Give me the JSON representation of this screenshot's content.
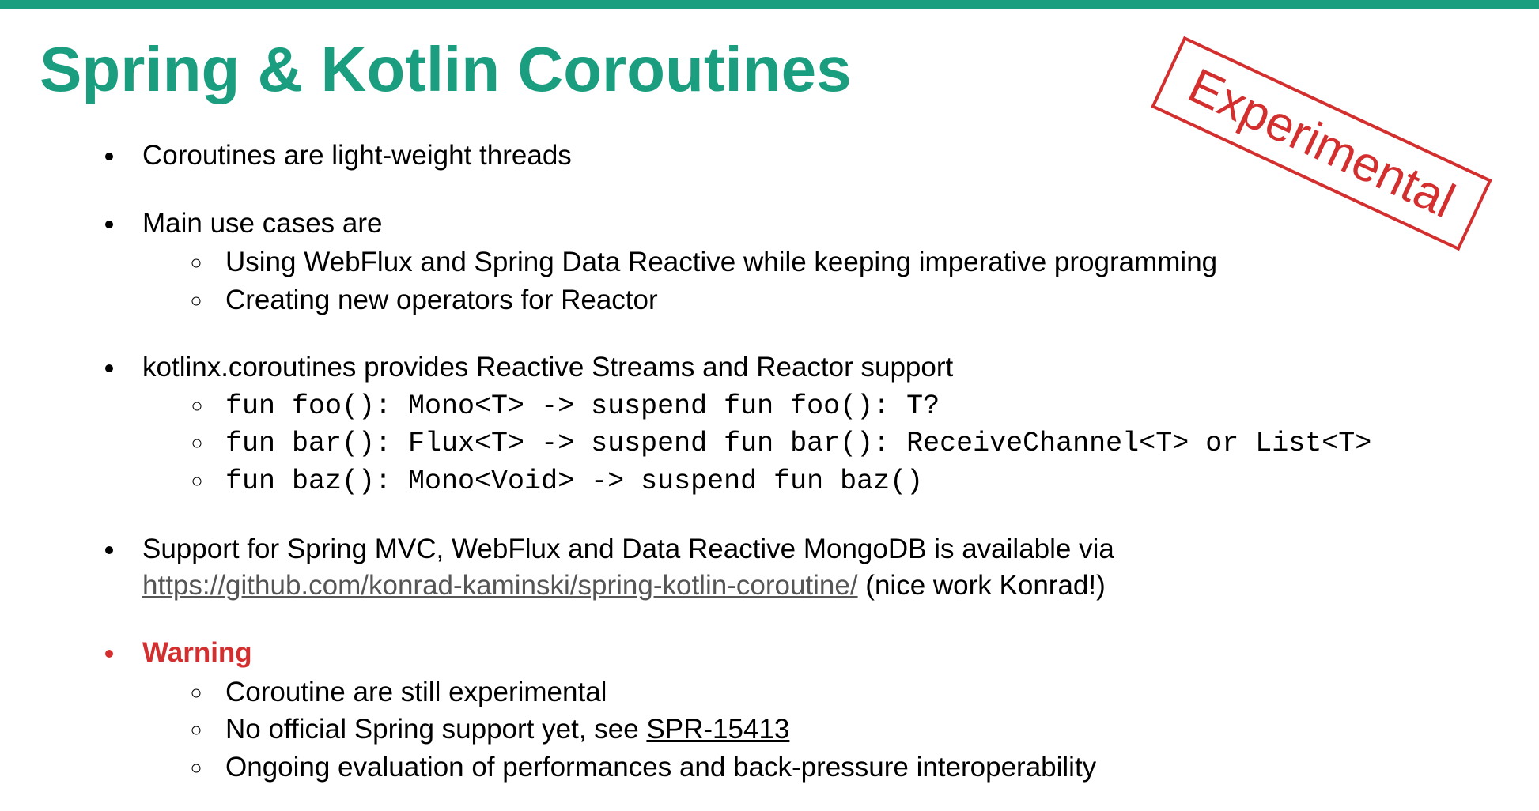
{
  "title": "Spring & Kotlin Coroutines",
  "stamp": "Experimental",
  "bullets": {
    "b1": "Coroutines are light-weight threads",
    "b2": "Main use cases are",
    "b2_sub": [
      "Using WebFlux and Spring Data Reactive while keeping imperative programming",
      "Creating new operators for Reactor"
    ],
    "b3": "kotlinx.coroutines provides Reactive Streams and Reactor support",
    "b3_sub": [
      "fun foo(): Mono<T>    -> suspend fun foo(): T?",
      "fun bar(): Flux<T>    -> suspend fun bar(): ReceiveChannel<T> or List<T>",
      "fun baz(): Mono<Void> -> suspend fun baz()"
    ],
    "b4_pre": "Support for Spring MVC, WebFlux and Data Reactive MongoDB is available via",
    "b4_link": "https://github.com/konrad-kaminski/spring-kotlin-coroutine/",
    "b4_post": " (nice work Konrad!)",
    "b5_label": "Warning",
    "b5_sub1": "Coroutine are still experimental",
    "b5_sub2_pre": "No official Spring support yet, see ",
    "b5_sub2_link": "SPR-15413",
    "b5_sub3": "Ongoing evaluation of performances and back-pressure interoperability"
  }
}
